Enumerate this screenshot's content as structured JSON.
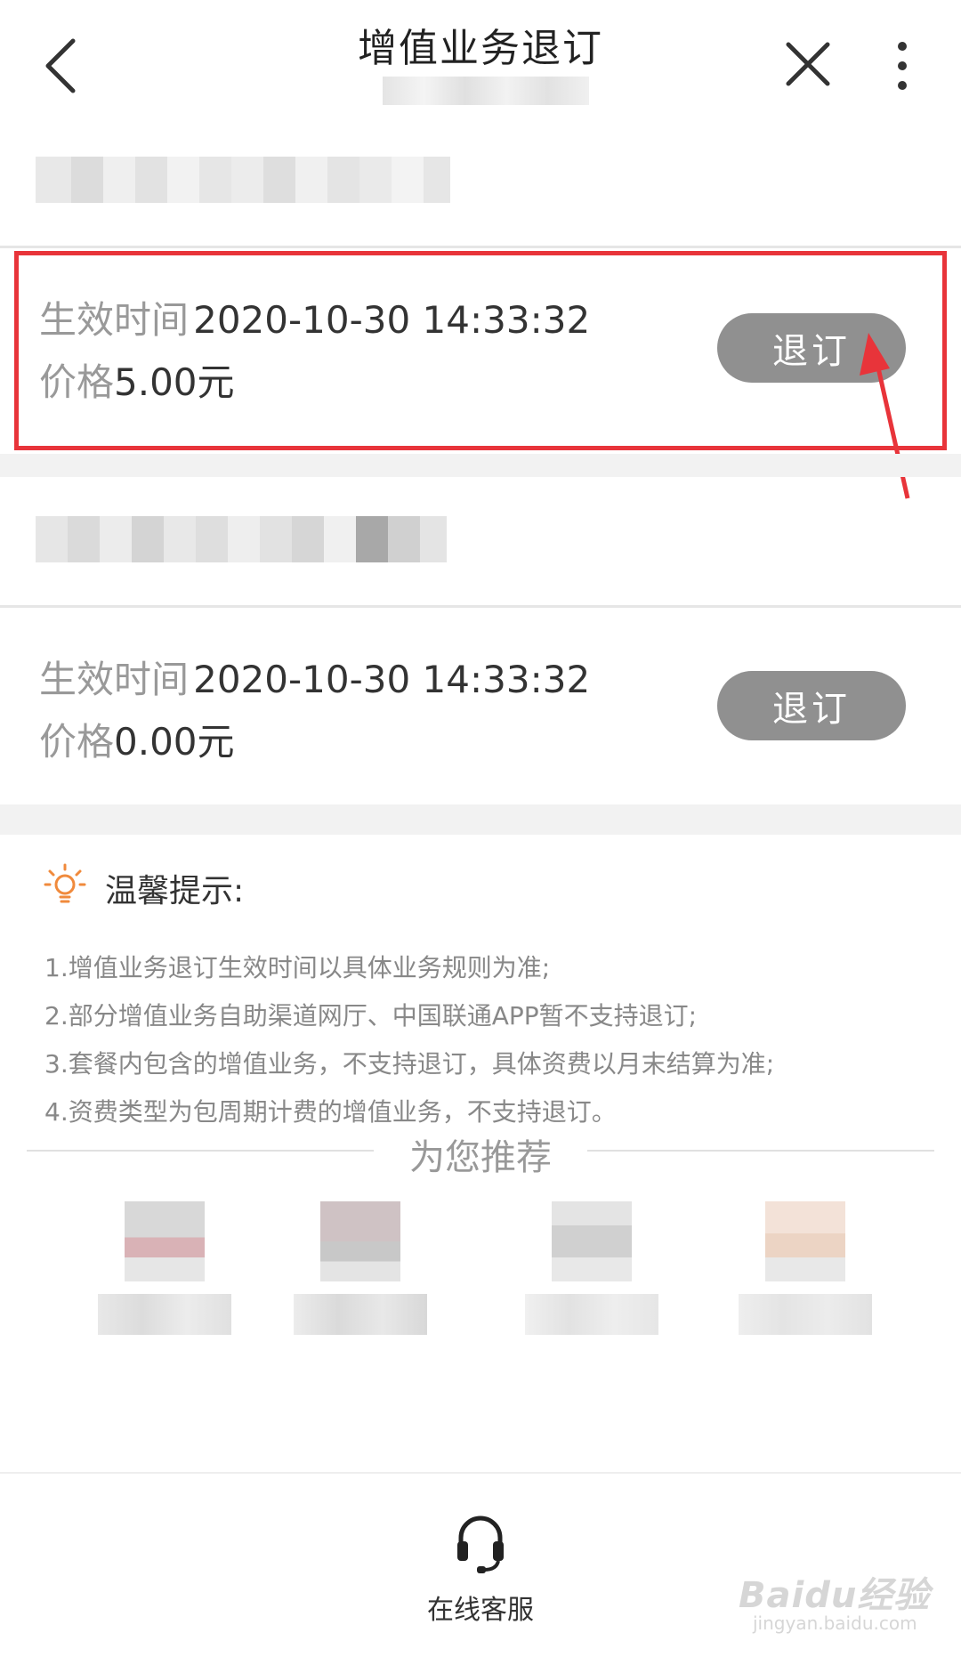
{
  "header": {
    "title": "增值业务退订",
    "back_icon": "chevron-left-icon",
    "close_icon": "close-icon",
    "more_icon": "more-vertical-icon"
  },
  "subscriptions": [
    {
      "effective_label": "生效时间",
      "effective_time": "2020-10-30 14:33:32",
      "price_label": "价格",
      "price_value": "5.00元",
      "unsubscribe_label": "退订",
      "highlighted": true
    },
    {
      "effective_label": "生效时间",
      "effective_time": "2020-10-30 14:33:32",
      "price_label": "价格",
      "price_value": "0.00元",
      "unsubscribe_label": "退订",
      "highlighted": false
    }
  ],
  "tips": {
    "icon": "lightbulb-icon",
    "title": "温馨提示:",
    "items": [
      "1.增值业务退订生效时间以具体业务规则为准;",
      "2.部分增值业务自助渠道网厅、中国联通APP暂不支持退订;",
      "3.套餐内包含的增值业务，不支持退订，具体资费以月末结算为准;",
      "4.资费类型为包周期计费的增值业务，不支持退订。"
    ]
  },
  "recommend": {
    "title": "为您推荐"
  },
  "footer": {
    "customer_service_label": "在线客服",
    "customer_service_icon": "headset-icon"
  },
  "watermark": {
    "main": "Baidu经验",
    "sub": "jingyan.baidu.com"
  },
  "colors": {
    "highlight_border": "#e8343a",
    "button_bg": "#909090",
    "tips_icon": "#f08a3c",
    "arrow": "#e8343a"
  }
}
